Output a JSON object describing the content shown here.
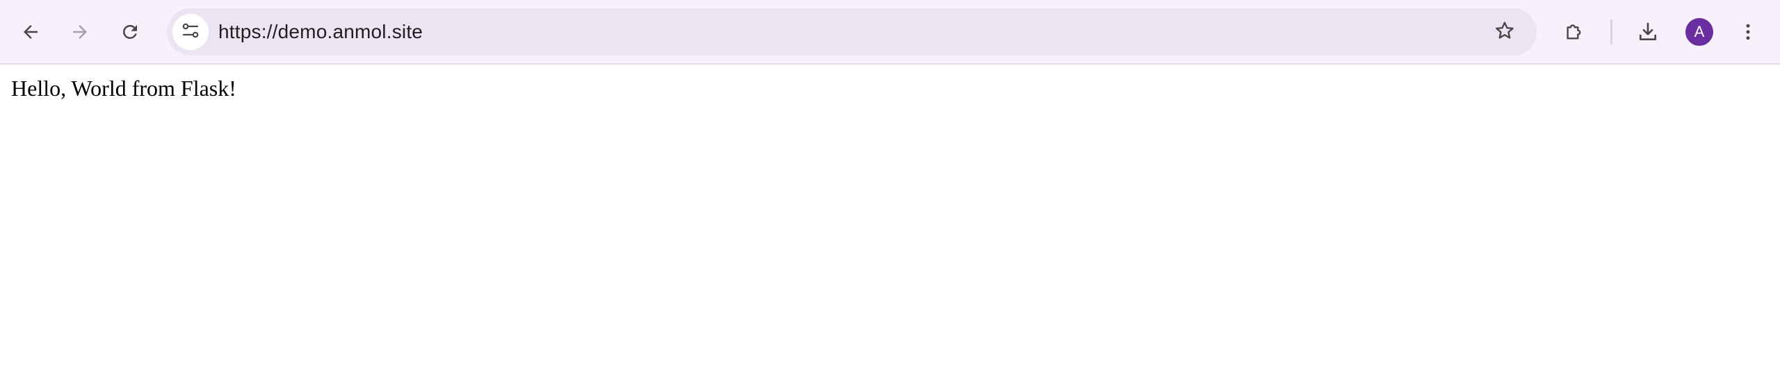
{
  "browser": {
    "url": "https://demo.anmol.site",
    "profile_initial": "A",
    "buttons": {
      "back": "back-arrow-icon",
      "forward": "forward-arrow-icon",
      "reload": "reload-icon",
      "site_info": "tune-icon",
      "bookmark": "star-icon",
      "extensions": "puzzle-icon",
      "downloads": "download-icon",
      "menu": "vertical-dots-icon"
    },
    "colors": {
      "toolbar_bg": "#f8f1fc",
      "omnibox_bg": "#ece4f2",
      "avatar_bg": "#6a2ea0",
      "forward_disabled": "#a79fab"
    }
  },
  "page": {
    "body_text": "Hello, World from Flask!"
  }
}
